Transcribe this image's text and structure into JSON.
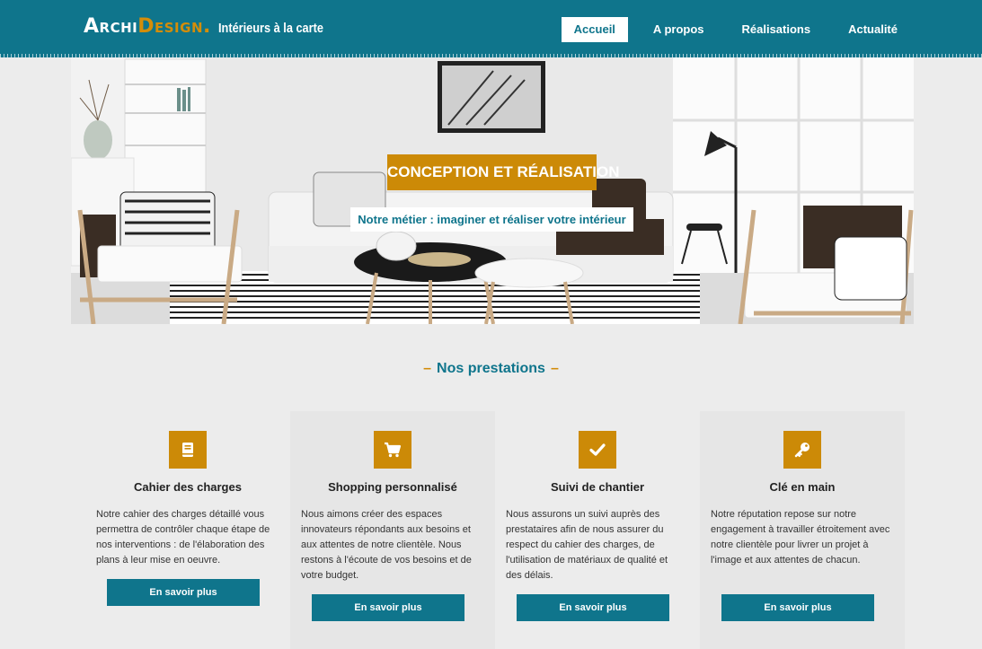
{
  "header": {
    "logo_archi": "Archi",
    "logo_design": "Design.",
    "tagline": "Intérieurs à la carte"
  },
  "nav": {
    "items": [
      {
        "label": "Accueil",
        "active": true
      },
      {
        "label": "A propos",
        "active": false
      },
      {
        "label": "Réalisations",
        "active": false
      },
      {
        "label": "Actualité",
        "active": false
      }
    ]
  },
  "hero": {
    "title": "CONCEPTION ET RÉALISATION",
    "subtitle": "Notre métier : imaginer et réaliser votre intérieur"
  },
  "section": {
    "title": "Nos prestations",
    "dash": "–"
  },
  "cards": [
    {
      "icon": "book-icon",
      "title": "Cahier des charges",
      "text": "Notre cahier des charges détaillé vous permettra de contrôler chaque étape de nos interventions : de l'élaboration des plans à leur mise en oeuvre.",
      "button": "En savoir plus"
    },
    {
      "icon": "shopping-cart-icon",
      "title": "Shopping personnalisé",
      "text": "Nous aimons créer des espaces innovateurs répondants aux besoins et aux attentes de notre clientèle. Nous restons à l'écoute de vos besoins et de votre budget.",
      "button": "En savoir plus"
    },
    {
      "icon": "checkmark-icon",
      "title": "Suivi de chantier",
      "text": "Nous assurons un suivi auprès des prestataires afin de nous assurer du respect du cahier des charges, de l'utilisation de matériaux de qualité et des délais.",
      "button": "En savoir plus"
    },
    {
      "icon": "key-icon",
      "title": "Clé en main",
      "text": "Notre réputation repose sur notre engagement à travailler étroitement avec notre clientèle pour livrer un projet à l'image et aux attentes de chacun.",
      "button": "En savoir plus"
    }
  ],
  "colors": {
    "primary": "#0f758c",
    "accent": "#cc8a07",
    "background": "#ececec"
  }
}
